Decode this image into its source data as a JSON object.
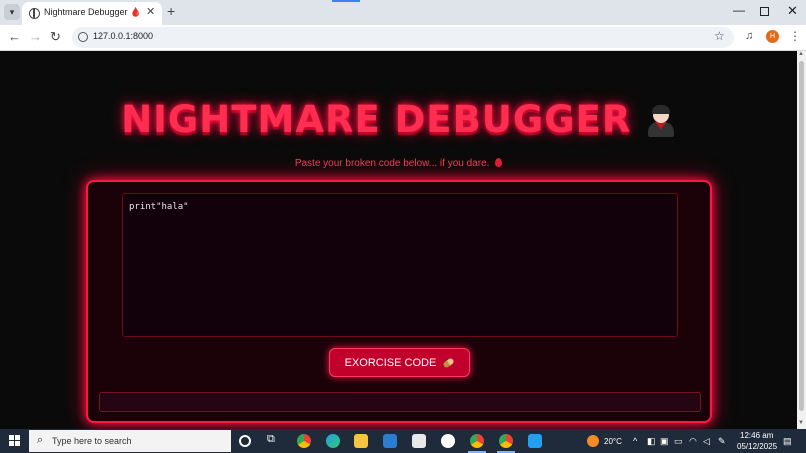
{
  "browser": {
    "tab_title": "Nightmare Debugger 🩸",
    "url": "127.0.0.1:8000",
    "profile_initial": "H"
  },
  "page": {
    "title": "NIGHTMARE DEBUGGER",
    "title_icon": "vampire-icon",
    "subtitle": "Paste your broken code below... if you dare.",
    "subtitle_icon": "drop-of-blood-icon",
    "code_value": "print\"hala\"",
    "button_label": "EXORCISE CODE",
    "button_icon": "pill-icon",
    "output_text": ""
  },
  "colors": {
    "accent": "#ff1744",
    "title": "#ff2d4f",
    "button": "#c2002c",
    "background": "#0a0a0a"
  },
  "taskbar": {
    "search_placeholder": "Type here to search",
    "temperature": "20°C",
    "time": "12:46 am",
    "date": "05/12/2025"
  }
}
